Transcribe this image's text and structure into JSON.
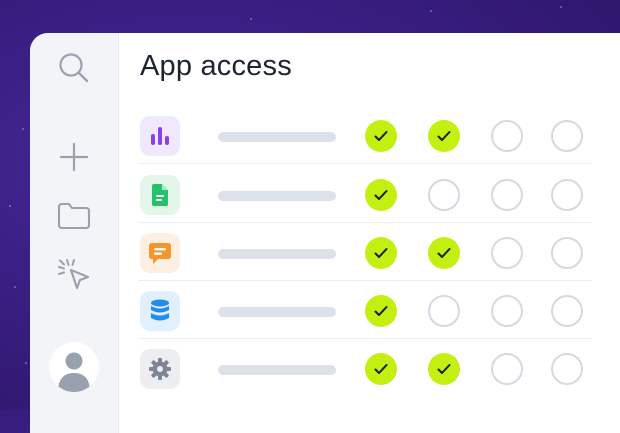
{
  "page": {
    "title": "App access"
  },
  "sidebar": {
    "icons": [
      "search-icon",
      "plus-icon",
      "folder-icon",
      "cursor-click-icon"
    ],
    "avatar": "user-avatar"
  },
  "colors": {
    "background": "#3a1e82",
    "checked": "#c3ef11",
    "unchecked_border": "#d5d9e2",
    "placeholder_bar": "#dde1ea"
  },
  "apps": [
    {
      "icon": "bar-chart-icon",
      "icon_color": "#8b3ff0",
      "icon_bg": "#f0e8fd",
      "permissions": [
        true,
        true,
        false,
        false
      ]
    },
    {
      "icon": "document-icon",
      "icon_color": "#23c26b",
      "icon_bg": "#e2f7ea",
      "permissions": [
        true,
        false,
        false,
        false
      ]
    },
    {
      "icon": "chat-icon",
      "icon_color": "#f7942e",
      "icon_bg": "#fdf0e2",
      "permissions": [
        true,
        true,
        false,
        false
      ]
    },
    {
      "icon": "database-icon",
      "icon_color": "#1f8ef0",
      "icon_bg": "#e2f0fd",
      "permissions": [
        true,
        false,
        false,
        false
      ]
    },
    {
      "icon": "gear-icon",
      "icon_color": "#7e8594",
      "icon_bg": "#eceef2",
      "permissions": [
        true,
        true,
        false,
        false
      ]
    }
  ]
}
